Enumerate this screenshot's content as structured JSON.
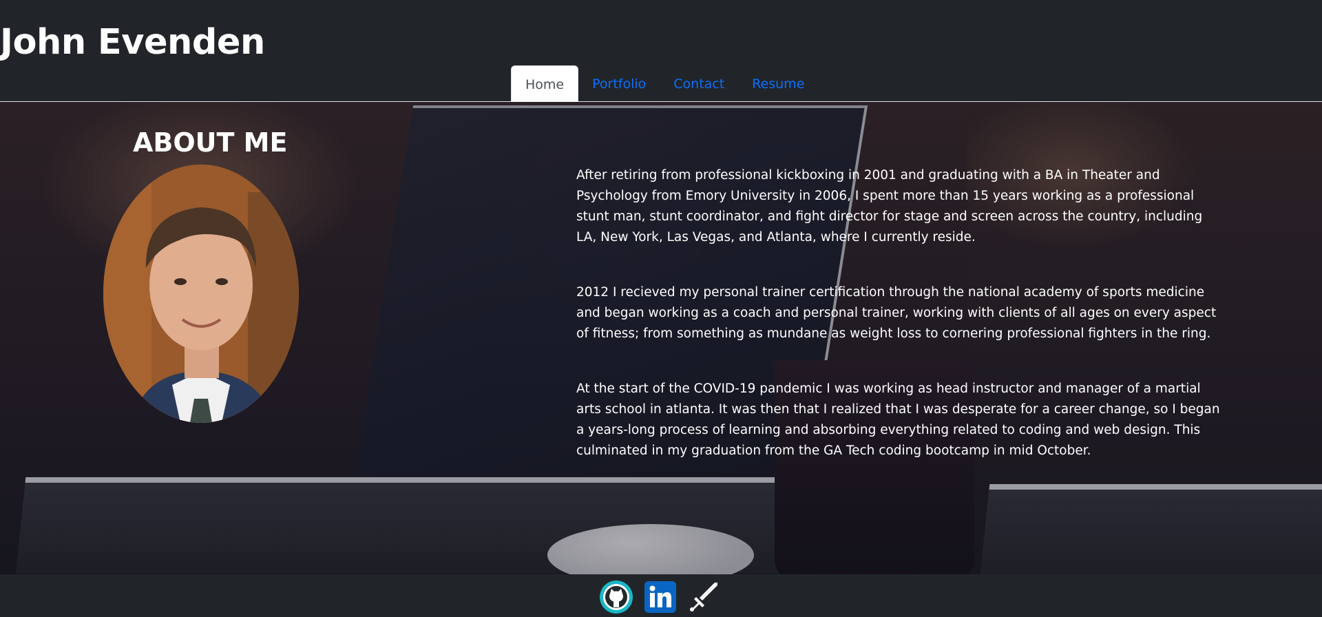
{
  "header": {
    "site_title": "John Evenden"
  },
  "nav": {
    "items": [
      {
        "label": "Home",
        "active": true
      },
      {
        "label": "Portfolio",
        "active": false
      },
      {
        "label": "Contact",
        "active": false
      },
      {
        "label": "Resume",
        "active": false
      }
    ]
  },
  "about": {
    "heading": "ABOUT ME",
    "paragraphs": [
      "After retiring from professional kickboxing in 2001 and graduating with a BA in Theater and Psychology from Emory University in 2006, I spent more than 15 years working as a professional stunt man, stunt coordinator, and fight director for stage and screen across the country, including LA, New York, Las Vegas, and Atlanta, where I currently reside.",
      "2012 I recieved my personal trainer certification through the national academy of sports medicine and began working as a coach and personal trainer, working with clients of all ages on every aspect of fitness; from something as mundane as weight loss to cornering professional fighters in the ring.",
      "At the start of the COVID-19 pandemic I was working as head instructor and manager of a martial arts school in atlanta. It was then that I realized that I was desperate for a career change, so I began a years-long process of learning and absorbing everything related to coding and web design. This culminated in my graduation from the GA Tech coding bootcamp in mid October."
    ]
  },
  "footer": {
    "icons": [
      "github-icon",
      "linkedin-icon",
      "sword-icon"
    ]
  },
  "colors": {
    "background": "#212529",
    "nav_link": "#0d6efd",
    "nav_active_text": "#495057",
    "text": "#ffffff",
    "github_ring": "#1ab7c6",
    "linkedin_blue": "#0a66c2"
  }
}
